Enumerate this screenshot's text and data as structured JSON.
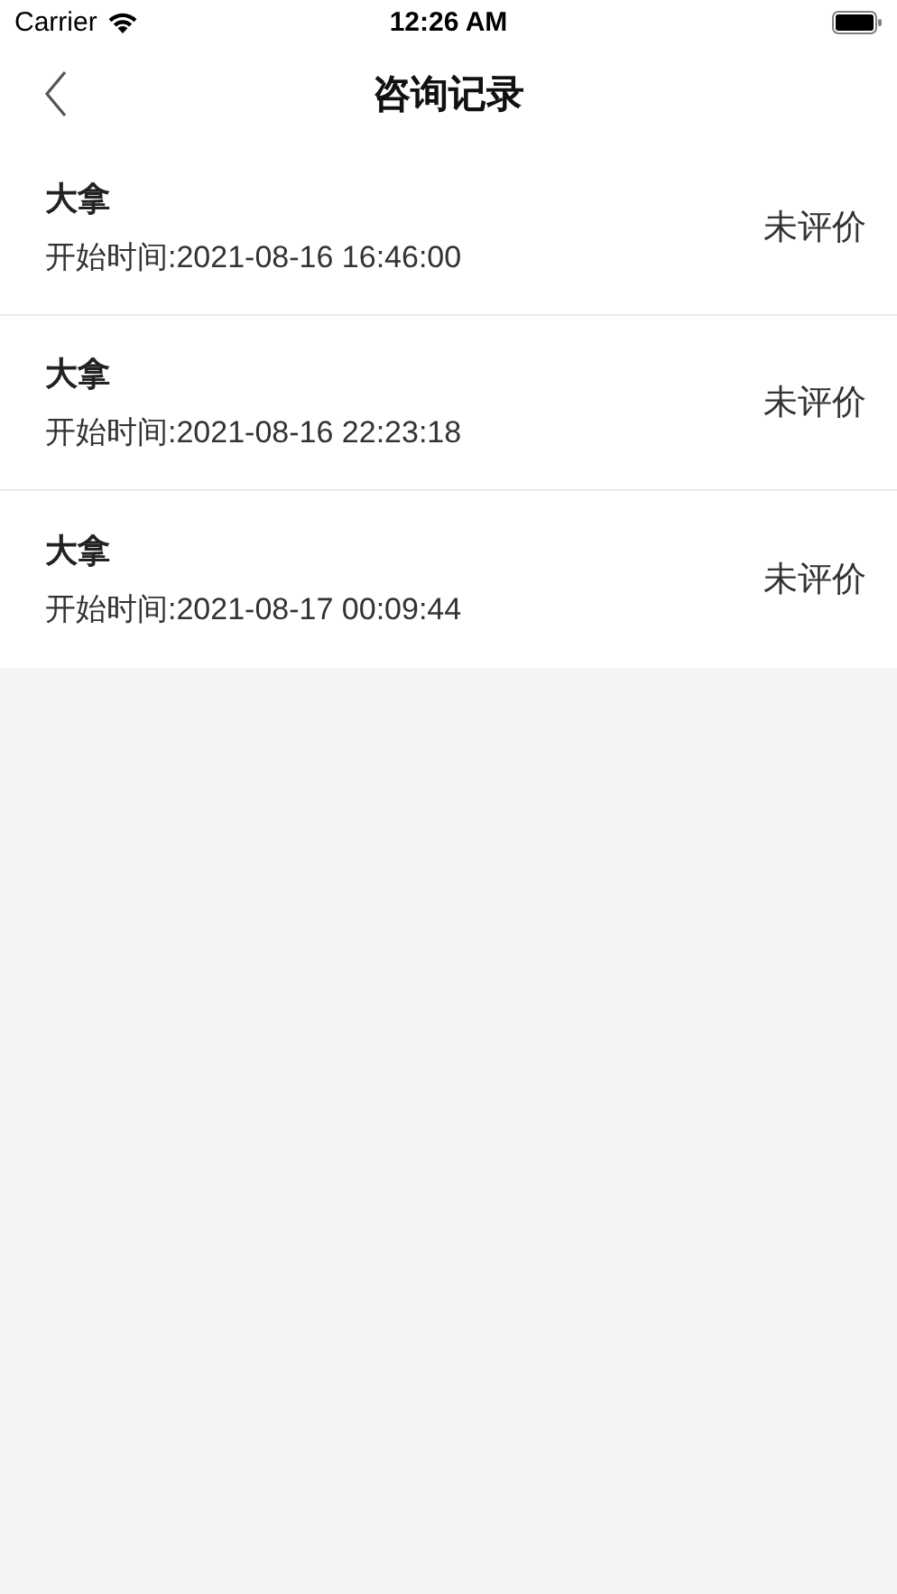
{
  "status_bar": {
    "carrier": "Carrier",
    "time": "12:26 AM"
  },
  "nav": {
    "title": "咨询记录"
  },
  "records": [
    {
      "name": "大拿",
      "start_time": "开始时间:2021-08-16 16:46:00",
      "status": "未评价"
    },
    {
      "name": "大拿",
      "start_time": "开始时间:2021-08-16 22:23:18",
      "status": "未评价"
    },
    {
      "name": "大拿",
      "start_time": "开始时间:2021-08-17 00:09:44",
      "status": "未评价"
    }
  ]
}
